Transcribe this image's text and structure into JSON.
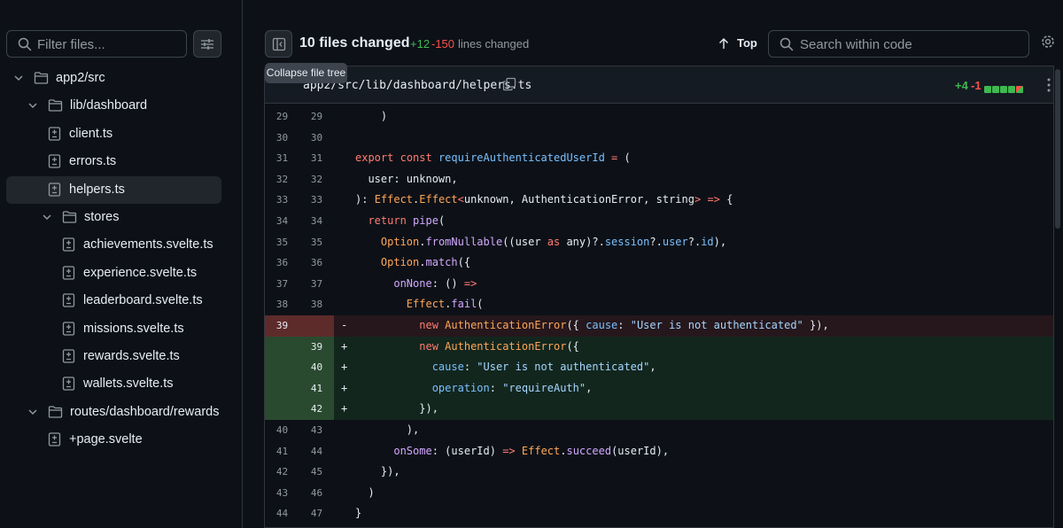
{
  "sidebar": {
    "filter_placeholder": "Filter files...",
    "tree": [
      {
        "label": "app2/src",
        "type": "folder",
        "depth": 0,
        "expanded": true
      },
      {
        "label": "lib/dashboard",
        "type": "folder",
        "depth": 1,
        "expanded": true
      },
      {
        "label": "client.ts",
        "type": "file",
        "depth": 2
      },
      {
        "label": "errors.ts",
        "type": "file",
        "depth": 2
      },
      {
        "label": "helpers.ts",
        "type": "file",
        "depth": 2,
        "selected": true
      },
      {
        "label": "stores",
        "type": "folder",
        "depth": 2,
        "expanded": true
      },
      {
        "label": "achievements.svelte.ts",
        "type": "file",
        "depth": 3
      },
      {
        "label": "experience.svelte.ts",
        "type": "file",
        "depth": 3
      },
      {
        "label": "leaderboard.svelte.ts",
        "type": "file",
        "depth": 3
      },
      {
        "label": "missions.svelte.ts",
        "type": "file",
        "depth": 3
      },
      {
        "label": "rewards.svelte.ts",
        "type": "file",
        "depth": 3
      },
      {
        "label": "wallets.svelte.ts",
        "type": "file",
        "depth": 3
      },
      {
        "label": "routes/dashboard/rewards",
        "type": "folder",
        "depth": 1,
        "expanded": true
      },
      {
        "label": "+page.svelte",
        "type": "file",
        "depth": 2
      }
    ]
  },
  "header": {
    "files_changed": "10 files changed",
    "additions": "+12",
    "deletions": "-150",
    "lines_changed": "lines changed",
    "top_label": "Top",
    "search_placeholder": "Search within code",
    "tooltip": "Collapse file tree"
  },
  "file": {
    "path": "app2/src/lib/dashboard/helpers.ts",
    "additions": "+4",
    "deletions": "-1",
    "diffstat": [
      "add",
      "add",
      "add",
      "add",
      "mixed"
    ]
  },
  "colors": {
    "addition": "#3fb950",
    "deletion": "#f85149",
    "background": "#0d1117"
  },
  "code_lines": [
    {
      "old": "29",
      "new": "29",
      "type": "ctx",
      "sign": "",
      "tokens": [
        [
          "v",
          "    )"
        ]
      ]
    },
    {
      "old": "30",
      "new": "30",
      "type": "ctx",
      "sign": "",
      "tokens": []
    },
    {
      "old": "31",
      "new": "31",
      "type": "ctx",
      "sign": "",
      "tokens": [
        [
          "k",
          "export"
        ],
        [
          "v",
          " "
        ],
        [
          "k",
          "const"
        ],
        [
          "v",
          " "
        ],
        [
          "p",
          "requireAuthenticatedUserId"
        ],
        [
          "v",
          " "
        ],
        [
          "k",
          "="
        ],
        [
          "v",
          " ("
        ]
      ]
    },
    {
      "old": "32",
      "new": "32",
      "type": "ctx",
      "sign": "",
      "tokens": [
        [
          "v",
          "  user: unknown,"
        ]
      ]
    },
    {
      "old": "33",
      "new": "33",
      "type": "ctx",
      "sign": "",
      "tokens": [
        [
          "v",
          "): "
        ],
        [
          "t",
          "Effect"
        ],
        [
          "v",
          "."
        ],
        [
          "t",
          "Effect"
        ],
        [
          "k",
          "<"
        ],
        [
          "v",
          "unknown, AuthenticationError, string"
        ],
        [
          "k",
          ">"
        ],
        [
          "v",
          " "
        ],
        [
          "k",
          "=>"
        ],
        [
          "v",
          " {"
        ]
      ]
    },
    {
      "old": "34",
      "new": "34",
      "type": "ctx",
      "sign": "",
      "tokens": [
        [
          "v",
          "  "
        ],
        [
          "k",
          "return"
        ],
        [
          "v",
          " "
        ],
        [
          "f",
          "pipe"
        ],
        [
          "v",
          "("
        ]
      ]
    },
    {
      "old": "35",
      "new": "35",
      "type": "ctx",
      "sign": "",
      "tokens": [
        [
          "v",
          "    "
        ],
        [
          "t",
          "Option"
        ],
        [
          "v",
          "."
        ],
        [
          "f",
          "fromNullable"
        ],
        [
          "v",
          "((user "
        ],
        [
          "k",
          "as"
        ],
        [
          "v",
          " any)?."
        ],
        [
          "p",
          "session"
        ],
        [
          "v",
          "?."
        ],
        [
          "p",
          "user"
        ],
        [
          "v",
          "?."
        ],
        [
          "p",
          "id"
        ],
        [
          "v",
          "),"
        ]
      ]
    },
    {
      "old": "36",
      "new": "36",
      "type": "ctx",
      "sign": "",
      "tokens": [
        [
          "v",
          "    "
        ],
        [
          "t",
          "Option"
        ],
        [
          "v",
          "."
        ],
        [
          "f",
          "match"
        ],
        [
          "v",
          "({"
        ]
      ]
    },
    {
      "old": "37",
      "new": "37",
      "type": "ctx",
      "sign": "",
      "tokens": [
        [
          "v",
          "      "
        ],
        [
          "f",
          "onNone"
        ],
        [
          "v",
          ": () "
        ],
        [
          "k",
          "=>"
        ]
      ]
    },
    {
      "old": "38",
      "new": "38",
      "type": "ctx",
      "sign": "",
      "tokens": [
        [
          "v",
          "        "
        ],
        [
          "t",
          "Effect"
        ],
        [
          "v",
          "."
        ],
        [
          "f",
          "fail"
        ],
        [
          "v",
          "("
        ]
      ]
    },
    {
      "old": "39",
      "new": "",
      "type": "del",
      "sign": "-",
      "tokens": [
        [
          "v",
          "          "
        ],
        [
          "k",
          "new"
        ],
        [
          "v",
          " "
        ],
        [
          "t",
          "AuthenticationError"
        ],
        [
          "v",
          "({ "
        ],
        [
          "p",
          "cause"
        ],
        [
          "v",
          ": "
        ],
        [
          "s",
          "\"User is not authenticated\""
        ],
        [
          "v",
          " }),"
        ]
      ]
    },
    {
      "old": "",
      "new": "39",
      "type": "add",
      "sign": "+",
      "tokens": [
        [
          "v",
          "          "
        ],
        [
          "k",
          "new"
        ],
        [
          "v",
          " "
        ],
        [
          "t",
          "AuthenticationError"
        ],
        [
          "v",
          "({"
        ]
      ]
    },
    {
      "old": "",
      "new": "40",
      "type": "add",
      "sign": "+",
      "tokens": [
        [
          "v",
          "            "
        ],
        [
          "p",
          "cause"
        ],
        [
          "v",
          ": "
        ],
        [
          "s",
          "\"User is not authenticated\""
        ],
        [
          "v",
          ","
        ]
      ]
    },
    {
      "old": "",
      "new": "41",
      "type": "add",
      "sign": "+",
      "tokens": [
        [
          "v",
          "            "
        ],
        [
          "p",
          "operation"
        ],
        [
          "v",
          ": "
        ],
        [
          "s",
          "\"requireAuth\""
        ],
        [
          "v",
          ","
        ]
      ]
    },
    {
      "old": "",
      "new": "42",
      "type": "add",
      "sign": "+",
      "tokens": [
        [
          "v",
          "          }),"
        ]
      ]
    },
    {
      "old": "40",
      "new": "43",
      "type": "ctx",
      "sign": "",
      "tokens": [
        [
          "v",
          "        ),"
        ]
      ]
    },
    {
      "old": "41",
      "new": "44",
      "type": "ctx",
      "sign": "",
      "tokens": [
        [
          "v",
          "      "
        ],
        [
          "f",
          "onSome"
        ],
        [
          "v",
          ": (userId) "
        ],
        [
          "k",
          "=>"
        ],
        [
          "v",
          " "
        ],
        [
          "t",
          "Effect"
        ],
        [
          "v",
          "."
        ],
        [
          "f",
          "succeed"
        ],
        [
          "v",
          "(userId),"
        ]
      ]
    },
    {
      "old": "42",
      "new": "45",
      "type": "ctx",
      "sign": "",
      "tokens": [
        [
          "v",
          "    }),"
        ]
      ]
    },
    {
      "old": "43",
      "new": "46",
      "type": "ctx",
      "sign": "",
      "tokens": [
        [
          "v",
          "  )"
        ]
      ]
    },
    {
      "old": "44",
      "new": "47",
      "type": "ctx",
      "sign": "",
      "tokens": [
        [
          "v",
          "}"
        ]
      ]
    }
  ]
}
